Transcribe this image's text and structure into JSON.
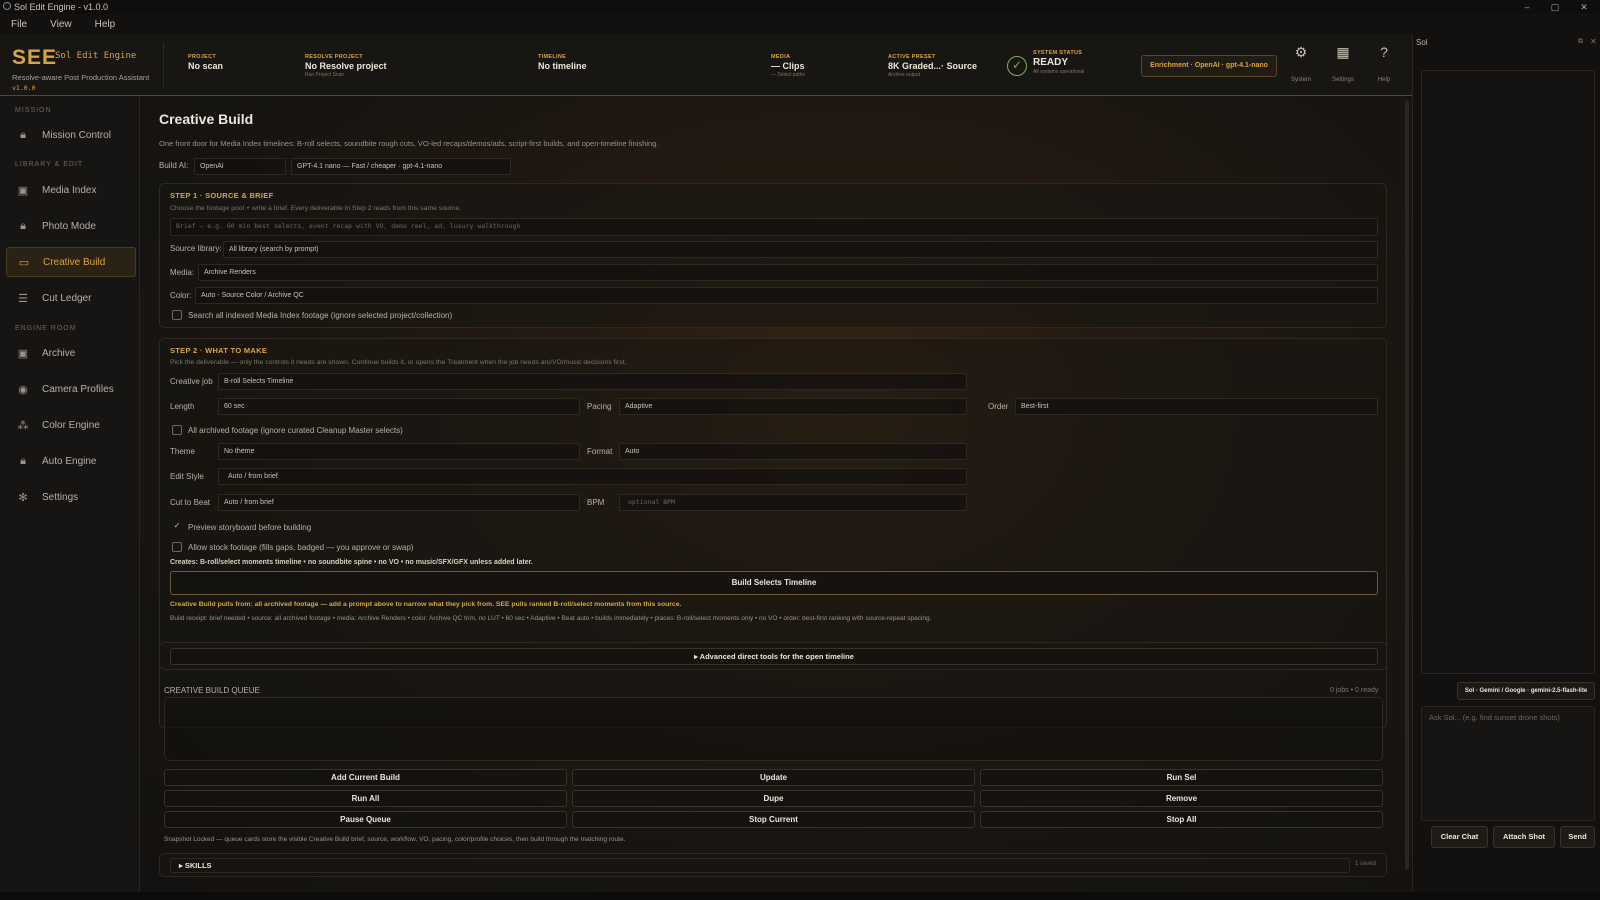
{
  "window": {
    "title": "Sol Edit Engine - v1.0.0",
    "controls": [
      "–",
      "▢",
      "✕"
    ]
  },
  "menu": [
    "File",
    "View",
    "Help"
  ],
  "brand": {
    "logo": "SEE",
    "name": "Sol Edit Engine",
    "tagline": "Resolve-aware Post Production Assistant",
    "version": "v1.0.0"
  },
  "header": {
    "project": {
      "label": "PROJECT",
      "value": "No scan"
    },
    "resolve_project": {
      "label": "RESOLVE PROJECT",
      "value": "No Resolve project",
      "sub": "Run Project Scan"
    },
    "timeline": {
      "label": "TIMELINE",
      "value": "No timeline"
    },
    "media": {
      "label": "MEDIA",
      "value": "— Clips",
      "sub": "— Select paths"
    },
    "active_preset": {
      "label": "ACTIVE PRESET",
      "value": "8K Graded...· Source",
      "sub": "Archive output"
    },
    "system_status": {
      "label": "SYSTEM STATUS",
      "value": "READY",
      "sub": "All systems operational"
    },
    "enrichment": "Enrichment · OpenAI · gpt-4.1-nano",
    "icons": [
      {
        "name": "System",
        "icon": "gear-icon"
      },
      {
        "name": "Settings",
        "icon": "grid-icon"
      },
      {
        "name": "Help",
        "icon": "help-icon"
      }
    ]
  },
  "sidebar": {
    "sections": {
      "mission": "MISSION",
      "library": "LIBRARY & EDIT",
      "engine": "ENGINE ROOM"
    },
    "items": [
      {
        "label": "Mission Control",
        "icon": "lock-icon"
      },
      {
        "label": "Media Index",
        "icon": "grid-icon"
      },
      {
        "label": "Photo Mode",
        "icon": "lock-icon"
      },
      {
        "label": "Creative Build",
        "icon": "folder-icon",
        "active": true
      },
      {
        "label": "Cut Ledger",
        "icon": "list-icon"
      },
      {
        "label": "Archive",
        "icon": "grid-icon"
      },
      {
        "label": "Camera Profiles",
        "icon": "camera-icon"
      },
      {
        "label": "Color Engine",
        "icon": "nodes-icon"
      },
      {
        "label": "Auto Engine",
        "icon": "lock-icon"
      },
      {
        "label": "Settings",
        "icon": "gear-icon"
      }
    ]
  },
  "page": {
    "title": "Creative Build",
    "description": "One front door for Media Index timelines: B-roll selects, soundbite rough cuts, VO-led recaps/demos/ads, script-first builds, and open-timeline finishing.",
    "build_ai_label": "Build AI:",
    "build_ai_provider": "OpenAI",
    "build_ai_model": "GPT-4.1 nano — Fast / cheaper · gpt-4.1-nano"
  },
  "step1": {
    "title": "STEP 1 · SOURCE & BRIEF",
    "note": "Choose the footage pool + write a brief. Every deliverable in Step 2 reads from this same source.",
    "brief_placeholder": "Brief — e.g. 60 min best selects, event recap with VO, demo reel, ad, luxury walkthrough",
    "source_label": "Source library:",
    "source_value": "All library (search by prompt)",
    "media_label": "Media:",
    "media_value": "Archive Renders",
    "color_label": "Color:",
    "color_value": "Auto - Source Color / Archive QC",
    "search_all": "Search all indexed Media Index footage (ignore selected project/collection)"
  },
  "step2": {
    "title": "STEP 2 · WHAT TO MAKE",
    "note": "Pick the deliverable — only the controls it needs are shown. Continue builds it, or opens the Treatment when the job needs arc/VO/music decisions first.",
    "creative_job_label": "Creative job",
    "creative_job_value": "B-roll Selects Timeline",
    "length_label": "Length",
    "length_value": "60 sec",
    "pacing_label": "Pacing",
    "pacing_value": "Adaptive",
    "order_label": "Order",
    "order_value": "Best-first",
    "all_archived": "All archived footage (ignore curated Cleanup Master selects)",
    "theme_label": "Theme",
    "theme_value": "No theme",
    "format_label": "Format",
    "format_value": "Auto",
    "edit_style_label": "Edit Style",
    "edit_style_value": "Auto / from brief",
    "cut_to_beat_label": "Cut to Beat",
    "cut_to_beat_value": "Auto / from brief",
    "bpm_label": "BPM",
    "bpm_placeholder": "optional BPM",
    "preview_storyboard": "Preview storyboard before building",
    "allow_stock": "Allow stock footage (fills gaps, badged — you approve or swap)",
    "creates": "Creates: B-roll/select moments timeline • no soundbite spine • no VO • no music/SFX/GFX unless added later.",
    "build_button": "Build Selects Timeline",
    "pulls_note": "Creative Build pulls from: all archived footage — add a prompt above to narrow what they pick from. SEE pulls ranked B-roll/select moments from this source.",
    "receipt": "Build receipt: brief needed • source: all archived footage • media: Archive Renders • color: Archive QC trim, no LUT • 60 sec • Adaptive • Beat auto • builds immediately • places: B-roll/select moments only • no VO • order: best-first ranking with source-repeat spacing."
  },
  "advanced": "▸ Advanced direct tools for the open timeline",
  "queue": {
    "title": "CREATIVE BUILD QUEUE",
    "count": "0 jobs • 0 ready",
    "buttons": [
      "Add Current Build",
      "Update",
      "Run Sel",
      "Run All",
      "Dupe",
      "Remove",
      "Pause Queue",
      "Stop Current",
      "Stop All"
    ],
    "note": "Snapshot Locked — queue cards store the visible Creative Build brief, source, workflow, VO, pacing, color/profile choices, then build through the matching route."
  },
  "skills": {
    "label": "SKILLS",
    "count": "1 saved"
  },
  "chat": {
    "title": "Sol",
    "model": "Sol · Gemini / Google · gemini-2.5-flash-lite",
    "placeholder": "Ask Sol... (e.g. find sunset drone shots)",
    "buttons": [
      "Clear Chat",
      "Attach Shot",
      "Send"
    ]
  }
}
